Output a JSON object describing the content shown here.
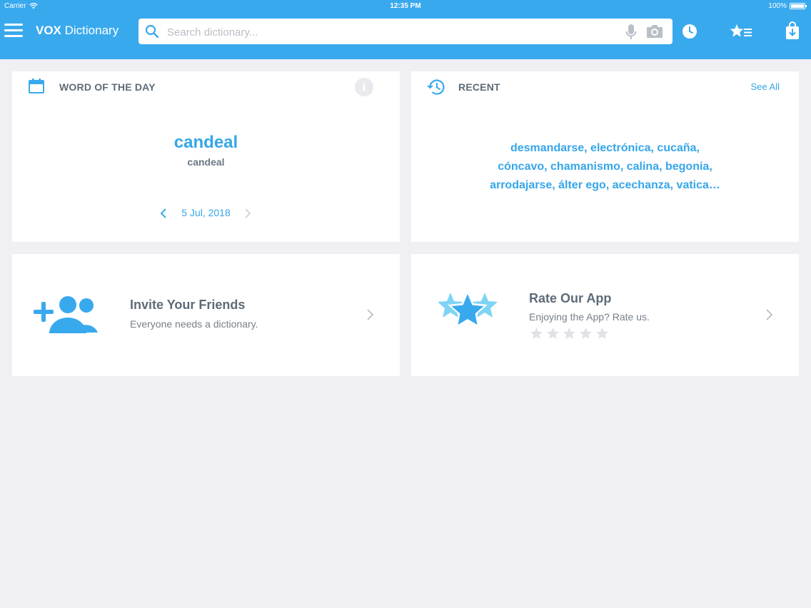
{
  "status": {
    "carrier": "Carrier",
    "time": "12:35 PM",
    "battery": "100%"
  },
  "app": {
    "title_bold": "VOX",
    "title_rest": " Dictionary"
  },
  "search": {
    "placeholder": "Search dictionary..."
  },
  "colors": {
    "brand": "#39a9ee",
    "accent_text": "#35a6e8",
    "background": "#efeff4"
  },
  "icons": {
    "menu": "menu-icon",
    "search": "search-icon",
    "mic": "microphone-icon",
    "camera": "camera-icon",
    "history": "clock-icon",
    "favorites": "star-list-icon",
    "store": "shopping-bag-icon",
    "calendar": "calendar-icon",
    "info": "info-icon",
    "recent": "history-icon",
    "invite": "add-friends-icon",
    "rate": "stars-icon"
  },
  "word_of_day": {
    "title": "WORD OF THE DAY",
    "info_symbol": "i",
    "word": "candeal",
    "subtitle": "candeal",
    "date": "5 Jul, 2018"
  },
  "recent": {
    "title": "RECENT",
    "see_all": "See All",
    "lines": [
      "desmandarse, electrónica, cucaña,",
      "cóncavo, chamanismo, calina, begonia,",
      "arrodajarse, álter ego, acechanza, vatica…"
    ]
  },
  "invite": {
    "title": "Invite Your Friends",
    "subtitle": "Everyone needs a dictionary."
  },
  "rate": {
    "title": "Rate Our App",
    "subtitle": "Enjoying the App? Rate us.",
    "rating": 0,
    "max_rating": 5
  }
}
